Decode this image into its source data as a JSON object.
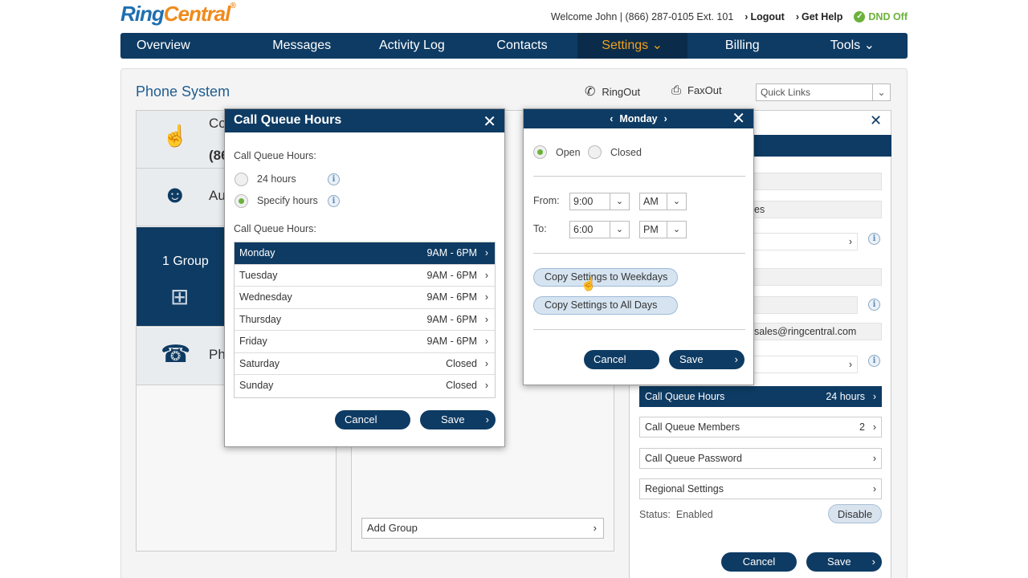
{
  "header": {
    "logo_ring": "Ring",
    "logo_central": "Central",
    "welcome": "Welcome John | (866) 287-0105 Ext. 101",
    "logout": "Logout",
    "get_help": "Get Help",
    "dnd": "DND Off"
  },
  "nav": {
    "items": [
      "Overview",
      "Messages",
      "Activity Log",
      "Contacts",
      "Settings",
      "Billing",
      "Tools"
    ],
    "active": "Settings"
  },
  "page": {
    "title": "Phone System",
    "ringout": "RingOut",
    "faxout": "FaxOut",
    "quick_links": "Quick Links",
    "left_tiles": [
      "Co",
      "Au",
      "1 Group",
      "Ph"
    ],
    "left_number_partial": "(86",
    "add_group": "Add Group"
  },
  "right_panel": {
    "field_fragment": "es",
    "email_fragment": "sales@ringcentral.com",
    "rows": [
      {
        "label": "Call Queue Hours",
        "value": "24 hours",
        "selected": true
      },
      {
        "label": "Call Queue Members",
        "value": "2",
        "selected": false
      },
      {
        "label": "Call Queue Password",
        "value": "",
        "selected": false
      },
      {
        "label": "Regional Settings",
        "value": "",
        "selected": false
      }
    ],
    "status_label": "Status:",
    "status_value": "Enabled",
    "disable": "Disable",
    "cancel": "Cancel",
    "save": "Save"
  },
  "call_queue_modal": {
    "title": "Call Queue Hours",
    "section_label_1": "Call Queue Hours:",
    "opt_24": "24 hours",
    "opt_specify": "Specify hours",
    "selected_option": "Specify hours",
    "section_label_2": "Call Queue Hours:",
    "days": [
      {
        "day": "Monday",
        "hours": "9AM - 6PM"
      },
      {
        "day": "Tuesday",
        "hours": "9AM - 6PM"
      },
      {
        "day": "Wednesday",
        "hours": "9AM - 6PM"
      },
      {
        "day": "Thursday",
        "hours": "9AM - 6PM"
      },
      {
        "day": "Friday",
        "hours": "9AM - 6PM"
      },
      {
        "day": "Saturday",
        "hours": "Closed"
      },
      {
        "day": "Sunday",
        "hours": "Closed"
      }
    ],
    "selected_day": "Monday",
    "cancel": "Cancel",
    "save": "Save"
  },
  "day_modal": {
    "day": "Monday",
    "open": "Open",
    "closed": "Closed",
    "selected_state": "Open",
    "from_label": "From:",
    "to_label": "To:",
    "from_time": "9:00",
    "from_ampm": "AM",
    "to_time": "6:00",
    "to_ampm": "PM",
    "copy_weekdays": "Copy Settings to Weekdays",
    "copy_all": "Copy Settings to All Days",
    "cancel": "Cancel",
    "save": "Save"
  },
  "colors": {
    "navy": "#0e3b63",
    "accent_orange": "#f0a21c",
    "green": "#6bb23a"
  }
}
